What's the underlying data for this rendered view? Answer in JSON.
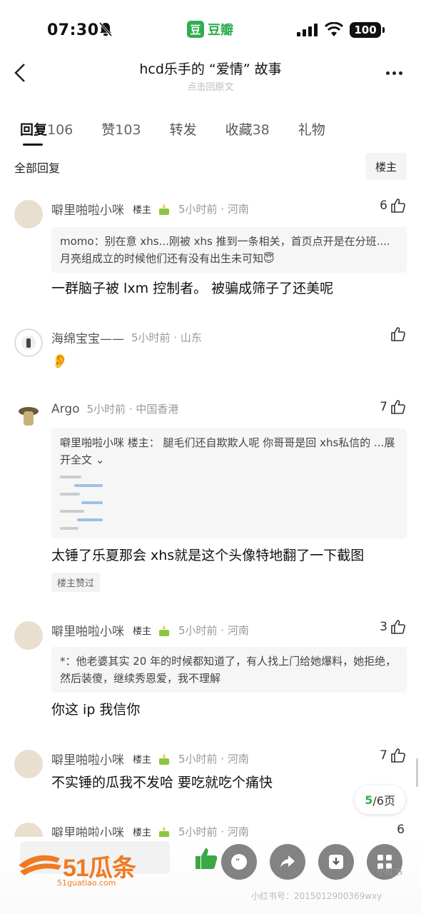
{
  "status_bar": {
    "time": "07:30",
    "app": "豆瓣",
    "app_logo_char": "豆",
    "battery": "100"
  },
  "header": {
    "title": "hcd乐手的 “爱情” 故事",
    "subtitle": "点击回原文"
  },
  "tabs": [
    {
      "label": "回复",
      "count": "106"
    },
    {
      "label": "赞",
      "count": "103"
    },
    {
      "label": "转发",
      "count": ""
    },
    {
      "label": "收藏",
      "count": "38"
    },
    {
      "label": "礼物",
      "count": ""
    }
  ],
  "sub_header": {
    "all_replies": "全部回复",
    "filter": "楼主"
  },
  "comments": [
    {
      "name": "噼里啪啦小咪",
      "tag": "楼主",
      "time_location": "5小时前 · 河南",
      "likes": "6",
      "quote": "momo：别在意 xhs...刚被 xhs 推到一条相关，首页点开是在分班....月亮组成立的时候他们还有没有出生未可知😇",
      "body": "一群脑子被 lxm 控制者。 被骗成筛子了还美呢"
    },
    {
      "name": "海绵宝宝——",
      "time_location": "5小时前 · 山东",
      "likes": "",
      "body": "👂"
    },
    {
      "name": "Argo",
      "time_location": "5小时前 · 中国香港",
      "likes": "7",
      "quote": "噼里啪啦小咪 楼主： 腿毛们还自欺欺人呢 你哥哥是回 xhs私信的 ...展开全文 ⌄",
      "body": "太锤了乐夏那会 xhs就是这个头像特地翻了一下截图",
      "chip": "楼主赞过"
    },
    {
      "name": "噼里啪啦小咪",
      "tag": "楼主",
      "time_location": "5小时前 · 河南",
      "likes": "3",
      "quote": "*：他老婆其实 20 年的时候都知道了，有人找上门给她爆料，她拒绝，然后装傻，继续秀恩爱，我不理解",
      "body": "你这 ip 我信你"
    },
    {
      "name": "噼里啪啦小咪",
      "tag": "楼主",
      "time_location": "5小时前 · 河南",
      "likes": "7",
      "body": "不实锤的瓜我不发哈 要吃就吃个痛快"
    },
    {
      "name": "噼里啪啦小咪",
      "tag": "楼主",
      "time_location": "5小时前 · 河南",
      "likes": "6"
    }
  ],
  "pagination": {
    "current": "5",
    "total_text": "/6页"
  },
  "watermark": {
    "brand": "51瓜条",
    "url": "51guatiao.com",
    "xhs": "小红书",
    "xhs_id": "小红书号：2015012900369wxy"
  },
  "colors": {
    "accent_green": "#2fae4f",
    "watermark_orange": "#f07a22",
    "like_green": "#3aa844"
  }
}
